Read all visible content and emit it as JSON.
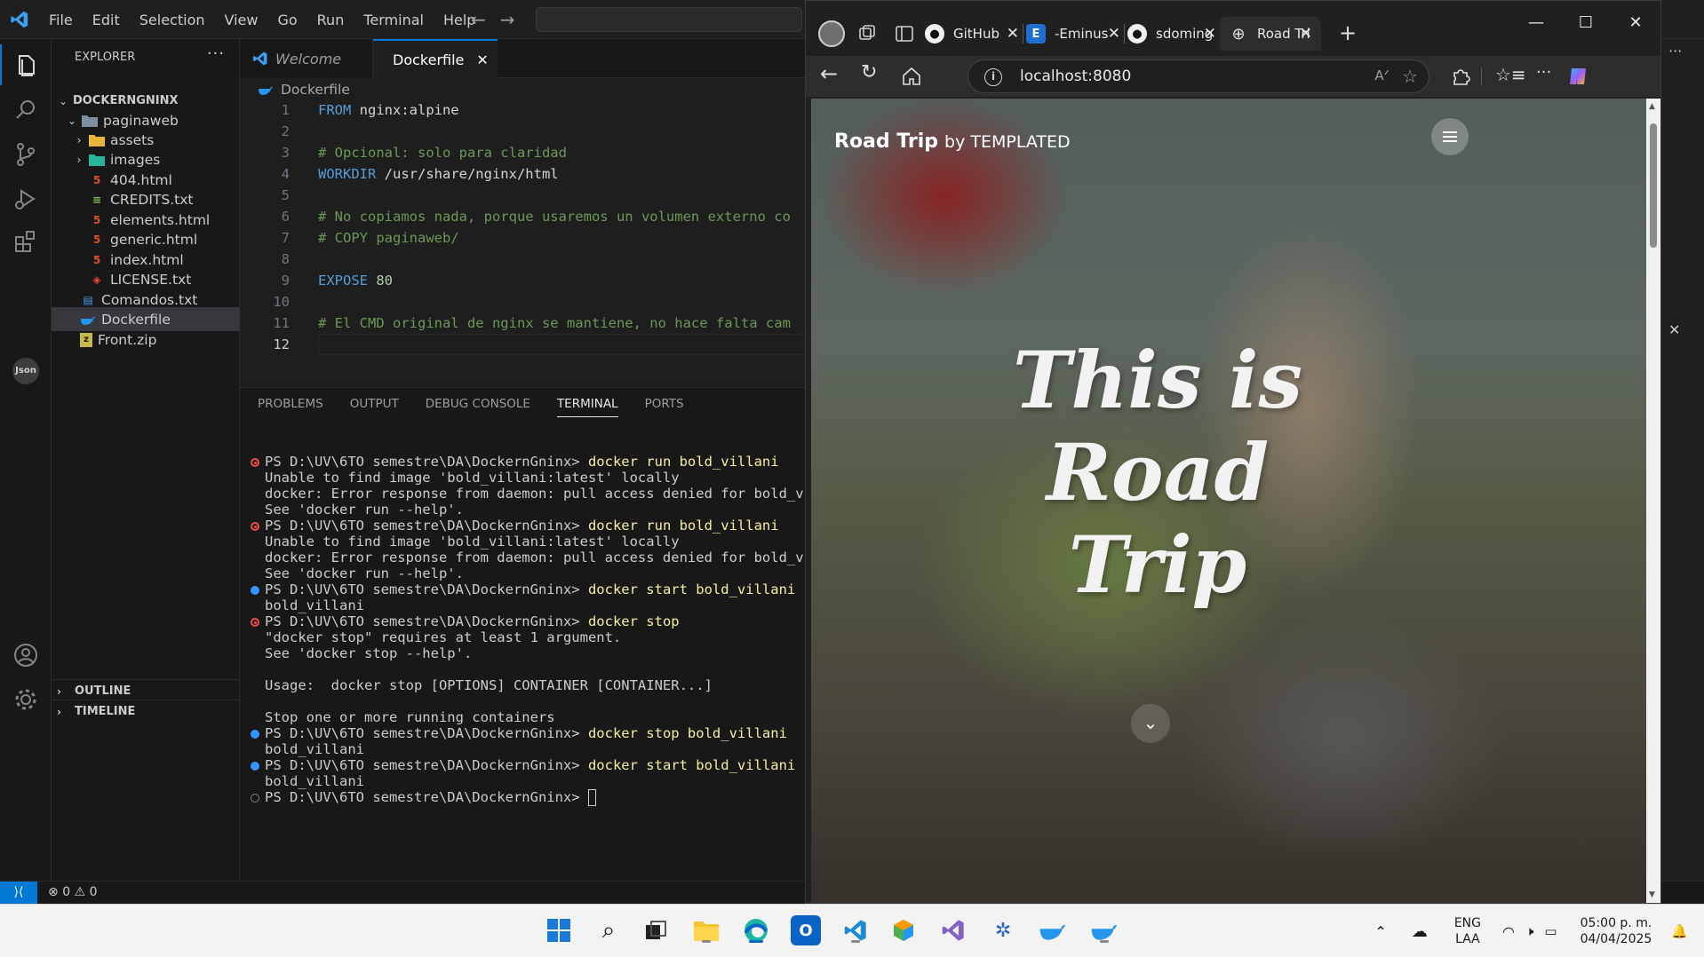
{
  "vscode": {
    "menu": [
      "File",
      "Edit",
      "Selection",
      "View",
      "Go",
      "Run",
      "Terminal",
      "Help"
    ],
    "explorer": {
      "title": "EXPLORER",
      "root": "DOCKERNGNINX",
      "folder": "paginaweb",
      "items": [
        {
          "label": "assets",
          "kind": "folder"
        },
        {
          "label": "images",
          "kind": "folder"
        },
        {
          "label": "404.html",
          "kind": "html"
        },
        {
          "label": "CREDITS.txt",
          "kind": "txt"
        },
        {
          "label": "elements.html",
          "kind": "html"
        },
        {
          "label": "generic.html",
          "kind": "html"
        },
        {
          "label": "index.html",
          "kind": "html"
        },
        {
          "label": "LICENSE.txt",
          "kind": "license"
        }
      ],
      "root_files": [
        {
          "label": "Comandos.txt",
          "kind": "doc"
        },
        {
          "label": "Dockerfile",
          "kind": "docker"
        },
        {
          "label": "Front.zip",
          "kind": "zip"
        }
      ],
      "sections": [
        "OUTLINE",
        "TIMELINE"
      ]
    },
    "tabs": [
      {
        "label": "Welcome"
      },
      {
        "label": "Dockerfile"
      }
    ],
    "breadcrumb": "Dockerfile",
    "code": [
      {
        "n": "1",
        "a": "FROM",
        "b": " nginx:alpine",
        "type": "kw"
      },
      {
        "n": "2",
        "a": "",
        "b": "",
        "type": "blank"
      },
      {
        "n": "3",
        "a": "# Opcional: solo para claridad",
        "b": "",
        "type": "cm"
      },
      {
        "n": "4",
        "a": "WORKDIR",
        "b": " /usr/share/nginx/html",
        "type": "kw"
      },
      {
        "n": "5",
        "a": "",
        "b": "",
        "type": "blank"
      },
      {
        "n": "6",
        "a": "# No copiamos nada, porque usaremos un volumen externo co",
        "b": "",
        "type": "cm"
      },
      {
        "n": "7",
        "a": "# COPY paginaweb/",
        "b": "",
        "type": "cm"
      },
      {
        "n": "8",
        "a": "",
        "b": "",
        "type": "blank"
      },
      {
        "n": "9",
        "a": "EXPOSE",
        "b": " 80",
        "type": "kwnum"
      },
      {
        "n": "10",
        "a": "",
        "b": "",
        "type": "blank"
      },
      {
        "n": "11",
        "a": "# El CMD original de nginx se mantiene, no hace falta cam",
        "b": "",
        "type": "cm"
      },
      {
        "n": "12",
        "a": "",
        "b": "",
        "type": "blank"
      }
    ],
    "panel_tabs": [
      "PROBLEMS",
      "OUTPUT",
      "DEBUG CONSOLE",
      "TERMINAL",
      "PORTS"
    ],
    "terminal": [
      {
        "dot": "red",
        "prompt": "PS D:\\UV\\6TO semestre\\DA\\DockernGninx> ",
        "cmd": "docker run bold_villani"
      },
      {
        "dot": "",
        "prompt": "Unable to find image 'bold_villani:latest' locally",
        "cmd": ""
      },
      {
        "dot": "",
        "prompt": "docker: Error response from daemon: pull access denied for bold_vill",
        "cmd": ""
      },
      {
        "dot": "",
        "prompt": "See 'docker run --help'.",
        "cmd": ""
      },
      {
        "dot": "red",
        "prompt": "PS D:\\UV\\6TO semestre\\DA\\DockernGninx> ",
        "cmd": "docker run bold_villani"
      },
      {
        "dot": "",
        "prompt": "Unable to find image 'bold_villani:latest' locally",
        "cmd": ""
      },
      {
        "dot": "",
        "prompt": "docker: Error response from daemon: pull access denied for bold_vill",
        "cmd": ""
      },
      {
        "dot": "",
        "prompt": "See 'docker run --help'.",
        "cmd": ""
      },
      {
        "dot": "blue",
        "prompt": "PS D:\\UV\\6TO semestre\\DA\\DockernGninx> ",
        "cmd": "docker start bold_villani"
      },
      {
        "dot": "",
        "prompt": "bold_villani",
        "cmd": ""
      },
      {
        "dot": "red",
        "prompt": "PS D:\\UV\\6TO semestre\\DA\\DockernGninx> ",
        "cmd": "docker stop"
      },
      {
        "dot": "",
        "prompt": "\"docker stop\" requires at least 1 argument.",
        "cmd": ""
      },
      {
        "dot": "",
        "prompt": "See 'docker stop --help'.",
        "cmd": ""
      },
      {
        "dot": "",
        "prompt": "",
        "cmd": ""
      },
      {
        "dot": "",
        "prompt": "Usage:  docker stop [OPTIONS] CONTAINER [CONTAINER...]",
        "cmd": ""
      },
      {
        "dot": "",
        "prompt": "",
        "cmd": ""
      },
      {
        "dot": "",
        "prompt": "Stop one or more running containers",
        "cmd": ""
      },
      {
        "dot": "blue",
        "prompt": "PS D:\\UV\\6TO semestre\\DA\\DockernGninx> ",
        "cmd": "docker stop bold_villani"
      },
      {
        "dot": "",
        "prompt": "bold_villani",
        "cmd": ""
      },
      {
        "dot": "blue",
        "prompt": "PS D:\\UV\\6TO semestre\\DA\\DockernGninx> ",
        "cmd": "docker start bold_villani"
      },
      {
        "dot": "",
        "prompt": "bold_villani",
        "cmd": ""
      },
      {
        "dot": "grey",
        "prompt": "PS D:\\UV\\6TO semestre\\DA\\DockernGninx> ",
        "cmd": ""
      }
    ],
    "status": {
      "errors": "0",
      "warnings": "0"
    }
  },
  "browser": {
    "tabs": [
      {
        "label": "GitHub",
        "icon": "github-icon"
      },
      {
        "label": "-Eminus",
        "icon": "eminus-icon"
      },
      {
        "label": "sdoming",
        "icon": "github-icon"
      },
      {
        "label": "Road Tri",
        "icon": "globe-icon"
      }
    ],
    "address": "localhost:8080",
    "site": {
      "logo_strong": "Road Trip",
      "logo_rest": "by TEMPLATED",
      "hero_line1": "This is Road",
      "hero_line2": "Trip"
    }
  },
  "taskbar": {
    "lang": "ENG",
    "region": "LAA",
    "time": "05:00 p. m.",
    "date": "04/04/2025"
  },
  "colors": {
    "vscode_accent": "#0078d4",
    "comment": "#6a9955",
    "keyword": "#569cd6",
    "error": "#f14c4c"
  }
}
